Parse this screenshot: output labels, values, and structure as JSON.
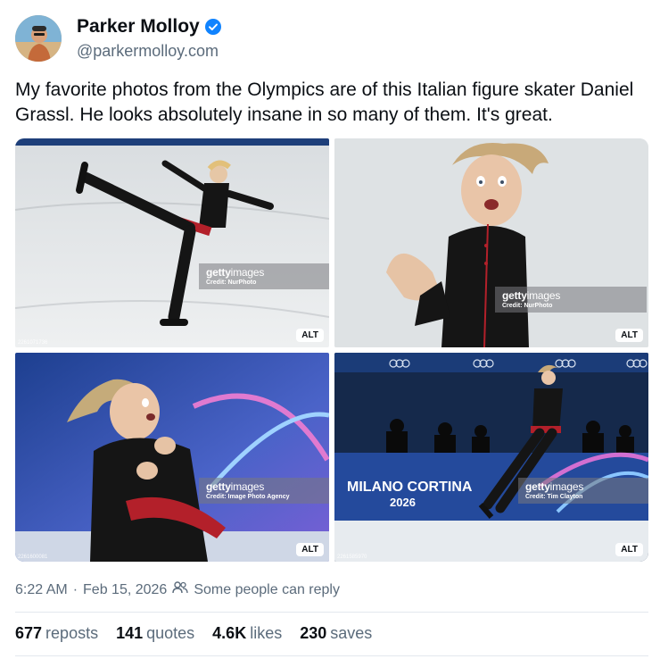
{
  "author": {
    "display_name": "Parker Molloy",
    "handle": "@parkermolloy.com",
    "verified_color": "#1083fe"
  },
  "post": {
    "text": "My favorite photos from the Olympics are of this Italian figure skater Daniel Grassl. He looks absolutely insane in so many of them. It's great.",
    "timestamp": "6:22 AM",
    "date": "Feb 15, 2026",
    "reply_setting": "Some people can reply"
  },
  "images": [
    {
      "getty_logo_bold": "getty",
      "getty_logo_light": "images",
      "credit": "Credit: NurPhoto",
      "alt_label": "ALT",
      "image_id": "2261071736"
    },
    {
      "getty_logo_bold": "getty",
      "getty_logo_light": "images",
      "credit": "Credit: NurPhoto",
      "alt_label": "ALT",
      "image_id": ""
    },
    {
      "getty_logo_bold": "getty",
      "getty_logo_light": "images",
      "credit": "Credit: Image Photo Agency",
      "alt_label": "ALT",
      "image_id": "2261600081"
    },
    {
      "getty_logo_bold": "getty",
      "getty_logo_light": "images",
      "credit": "Credit: Tim Clayton",
      "alt_label": "ALT",
      "image_id": "2261585970",
      "banner_text": "MILANO CORTINA",
      "banner_year": "2026"
    }
  ],
  "stats": [
    {
      "count": "677",
      "label": "reposts"
    },
    {
      "count": "141",
      "label": "quotes"
    },
    {
      "count": "4.6K",
      "label": "likes"
    },
    {
      "count": "230",
      "label": "saves"
    }
  ],
  "colors": {
    "text_primary": "#0b0f14",
    "text_secondary": "#5b6b7b",
    "divider": "#e3e8ee",
    "costume_red": "#b3202a"
  },
  "icons": {
    "verified": "verified-badge-icon",
    "reply_setting": "people-icon"
  }
}
